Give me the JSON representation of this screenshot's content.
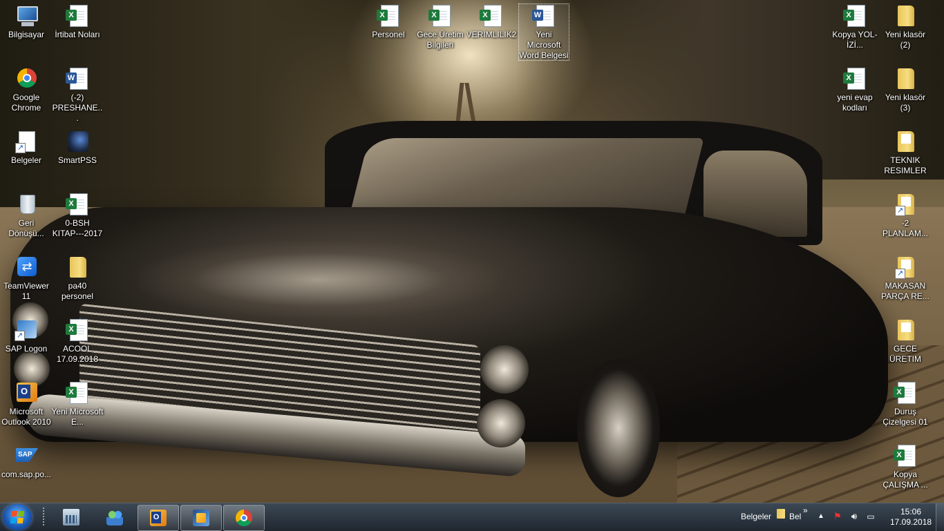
{
  "desktop": {
    "icons": {
      "bilgisayar": "Bilgisayar",
      "irtibat": "İrtibat Noları",
      "chrome": "Google Chrome",
      "preshane": "(-2) PRESHANE...",
      "belgeler": "Belgeler",
      "smartpss": "SmartPSS",
      "geri": "Geri Dönüşü...",
      "bsh": "0-BSH KITAP---2017",
      "teamviewer": "TeamViewer 11",
      "pa40": "pa40 personel",
      "saplogon": "SAP Logon",
      "acool": "ACOOL 17.09.2018",
      "outlook": "Microsoft Outlook 2010",
      "yeniexcel": "Yeni Microsoft E...",
      "comsap": "com.sap.po...",
      "personel": "Personel",
      "geceuretim": "Gece Üretim Bilgileri",
      "verimlilik": "VERIMLILIK2",
      "yeniword": "Yeni Microsoft Word Belgesi",
      "kopyayol": "Kopya YOL-İZİ...",
      "yeniklasor2": "Yeni klasör (2)",
      "yenievap": "yeni evap kodları",
      "yeniklasor3": "Yeni klasör (3)",
      "teknik": "TEKNIK RESIMLER",
      "planlam": "-2 PLANLAM...",
      "makasan": "MAKASAN PARÇA RE...",
      "geceuretim2": "GECE ÜRETIM",
      "durus": "Duruş Çizelgesi 01",
      "kopyacalisma": "Kopya ÇALIŞMA ..."
    }
  },
  "taskbar": {
    "toolbar_label": "Belgeler",
    "toolbar_item": "Bel",
    "chevron": "»",
    "time": "15:06",
    "date": "17.09.2018"
  }
}
